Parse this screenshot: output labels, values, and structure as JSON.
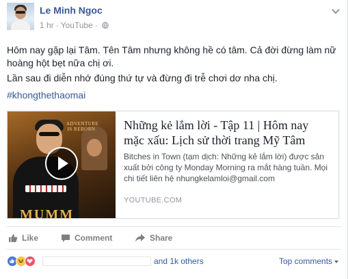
{
  "header": {
    "author": "Le Minh Ngoc",
    "time": "1 hr",
    "source": "YouTube",
    "privacy_icon": "globe-icon",
    "menu_icon": "chevron-down-icon"
  },
  "post": {
    "paragraph_1": "Hôm nay gặp lại Tâm. Tên Tâm nhưng không hề có tâm. Cả đời đừng làm nữ hoàng hột bẹt nữa chị ơi.",
    "paragraph_2": "Lần sau đi diễn nhớ đúng thứ tự và đừng đi trễ chơi dơ nha chị.",
    "hashtag": "#khongthethaomai"
  },
  "link_preview": {
    "title": "Những kẻ lắm lời - Tập 11 | Hôm nay mặc xấu: Lịch sử thời trang Mỹ Tâm",
    "description": "Bitches in Town (tạm dịch: Những kẻ lắm lời) được sản xuất bởi công ty Monday Morning ra mắt hàng tuần. Mọi chi tiết liên hệ nhungkelamloi@gmail.com",
    "domain": "YOUTUBE.COM",
    "thumbnail_text_top": "ADVENTURE IS REBORN",
    "thumbnail_text_bottom": "MUMM",
    "play_icon": "play-icon"
  },
  "actions": {
    "like": "Like",
    "comment": "Comment",
    "share": "Share"
  },
  "reactions": {
    "icons": [
      "like-reaction-icon",
      "haha-reaction-icon",
      "love-reaction-icon"
    ],
    "others_text": "and 1k others",
    "sort_label": "Top comments"
  },
  "colors": {
    "link_blue": "#365899",
    "meta_gray": "#90949c",
    "like_blue": "#4a78d4",
    "haha_yellow": "#f7c84a",
    "love_red": "#f25268"
  }
}
